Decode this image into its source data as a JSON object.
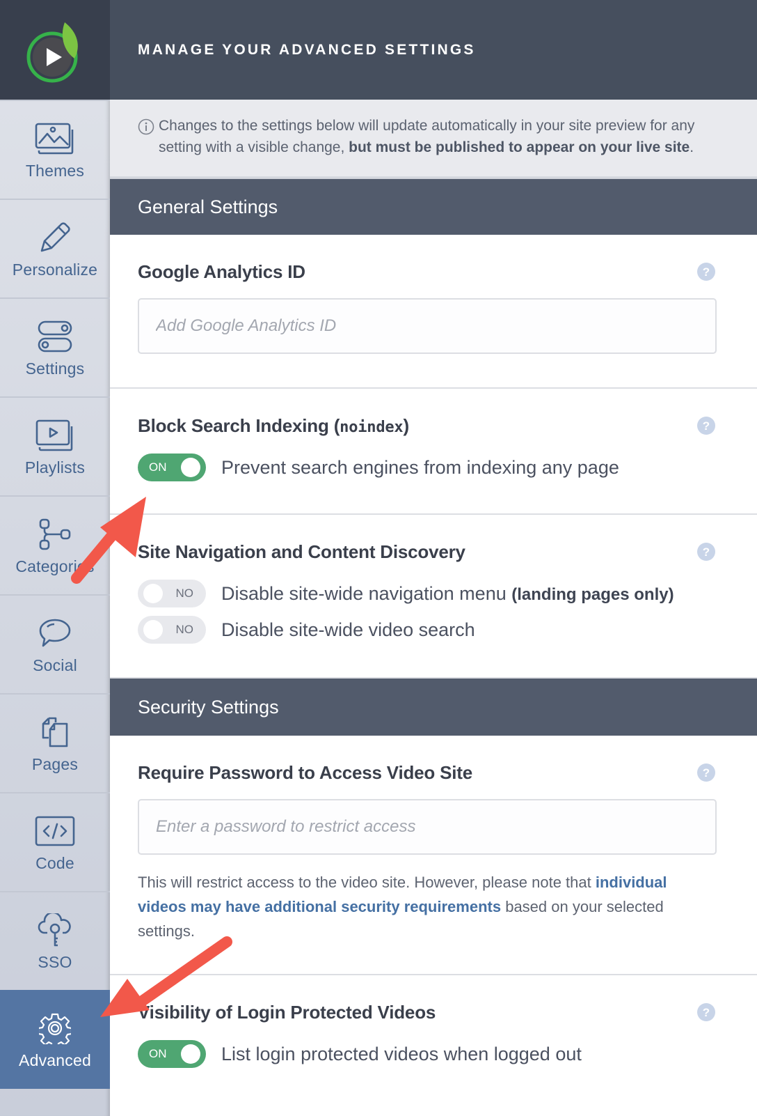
{
  "sidebar": {
    "logo": "play-leaf-logo",
    "items": [
      {
        "label": "Themes",
        "icon": "image-stack-icon",
        "active": false
      },
      {
        "label": "Personalize",
        "icon": "pencil-icon",
        "active": false
      },
      {
        "label": "Settings",
        "icon": "toggles-icon",
        "active": false
      },
      {
        "label": "Playlists",
        "icon": "playlist-icon",
        "active": false
      },
      {
        "label": "Categories",
        "icon": "hierarchy-icon",
        "active": false
      },
      {
        "label": "Social",
        "icon": "speech-bubble-icon",
        "active": false
      },
      {
        "label": "Pages",
        "icon": "pages-icon",
        "active": false
      },
      {
        "label": "Code",
        "icon": "code-icon",
        "active": false
      },
      {
        "label": "SSO",
        "icon": "cloud-key-icon",
        "active": false
      },
      {
        "label": "Advanced",
        "icon": "gear-icon",
        "active": true
      }
    ]
  },
  "header": {
    "title": "MANAGE YOUR ADVANCED SETTINGS"
  },
  "notice": {
    "text_plain": "Changes to the settings below will update automatically in your site preview for any setting with a visible change, ",
    "text_bold": "but must be published to appear on your live site",
    "text_end": "."
  },
  "general": {
    "title": "General Settings",
    "google_analytics": {
      "label": "Google Analytics ID",
      "value": "",
      "placeholder": "Add Google Analytics ID"
    },
    "block_indexing": {
      "label": "Block Search Indexing (",
      "label_code": "noindex",
      "label_end": ")",
      "toggle_state": "ON",
      "toggle_on": true,
      "toggle_text": "Prevent search engines from indexing any page"
    },
    "site_navigation": {
      "label": "Site Navigation and Content Discovery",
      "options": [
        {
          "state": "NO",
          "on": false,
          "text": "Disable site-wide navigation menu ",
          "text_bold": "(landing pages only)"
        },
        {
          "state": "NO",
          "on": false,
          "text": "Disable site-wide video search",
          "text_bold": ""
        }
      ]
    }
  },
  "security": {
    "title": "Security Settings",
    "password": {
      "label": "Require Password to Access Video Site",
      "value": "",
      "placeholder": "Enter a password to restrict access",
      "desc_before": "This will restrict access to the video site. However, please note that ",
      "desc_link": "individual videos may have additional security requirements",
      "desc_after": " based on your selected settings."
    },
    "login_visibility": {
      "label": "Visibility of Login Protected Videos",
      "toggle_state": "ON",
      "toggle_on": true,
      "toggle_text": "List login protected videos when logged out"
    }
  },
  "colors": {
    "accent_green": "#4fa672",
    "active_nav": "#5475a3",
    "header_bg": "#464f5e",
    "section_bg": "#525b6c",
    "annotation_arrow": "#f2584a"
  }
}
